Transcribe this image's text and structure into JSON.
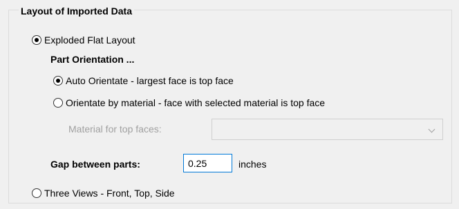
{
  "group": {
    "title": "Layout of Imported Data"
  },
  "exploded": {
    "label": "Exploded Flat Layout",
    "selected": true
  },
  "orientation": {
    "heading": "Part Orientation ...",
    "auto": {
      "label": "Auto Orientate - largest face is top face",
      "selected": true
    },
    "by_material": {
      "label": "Orientate by material - face with selected material is top face",
      "selected": false
    },
    "material_label": "Material for top faces:",
    "material_value": ""
  },
  "gap": {
    "label": "Gap between parts:",
    "value": "0.25",
    "unit": "inches"
  },
  "three_views": {
    "label": "Three Views - Front, Top, Side",
    "selected": false
  }
}
